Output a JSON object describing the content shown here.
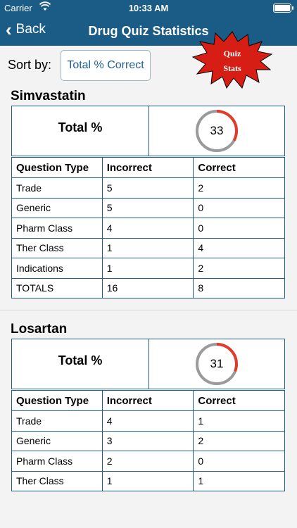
{
  "status_bar": {
    "carrier": "Carrier",
    "time": "10:33 AM"
  },
  "nav": {
    "back_label": "Back",
    "title": "Drug Quiz Statistics"
  },
  "sort": {
    "label": "Sort by:",
    "value": "Total % Correct"
  },
  "badge": {
    "line1": "Quiz",
    "line2": "Stats",
    "color": "#d61e14"
  },
  "colors": {
    "header": "#1a5c86",
    "ring_progress": "#e23b2b",
    "ring_track": "#9a9a9a"
  },
  "drugs": [
    {
      "name": "Simvastatin",
      "total_label": "Total %",
      "percent": "33",
      "headers": [
        "Question Type",
        "Incorrect",
        "Correct"
      ],
      "rows": [
        [
          "Trade",
          "5",
          "2"
        ],
        [
          "Generic",
          "5",
          "0"
        ],
        [
          "Pharm Class",
          "4",
          "0"
        ],
        [
          "Ther Class",
          "1",
          "4"
        ],
        [
          "Indications",
          "1",
          "2"
        ],
        [
          "TOTALS",
          "16",
          "8"
        ]
      ]
    },
    {
      "name": "Losartan",
      "total_label": "Total %",
      "percent": "31",
      "headers": [
        "Question Type",
        "Incorrect",
        "Correct"
      ],
      "rows": [
        [
          "Trade",
          "4",
          "1"
        ],
        [
          "Generic",
          "3",
          "2"
        ],
        [
          "Pharm Class",
          "2",
          "0"
        ],
        [
          "Ther Class",
          "1",
          "1"
        ]
      ]
    }
  ]
}
